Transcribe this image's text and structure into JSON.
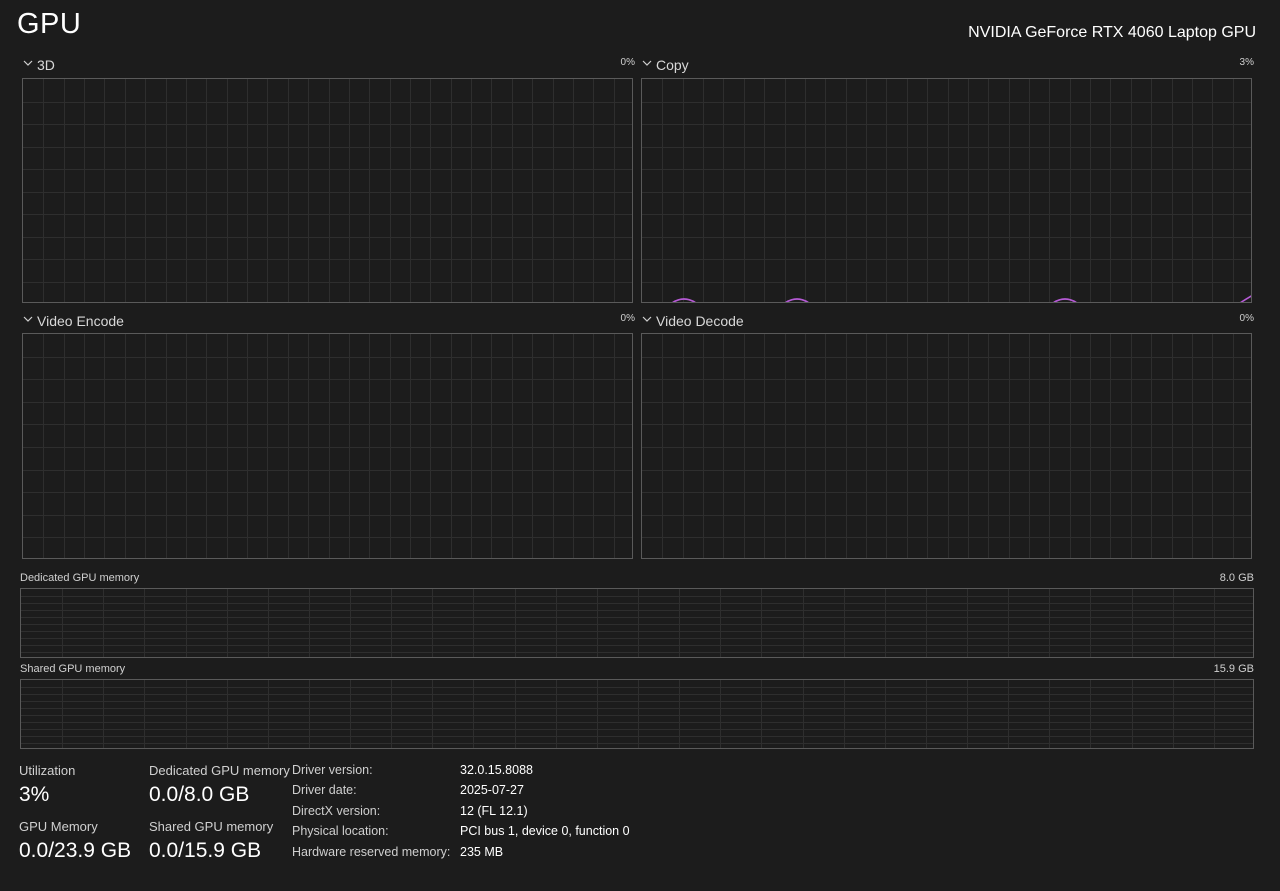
{
  "header": {
    "title": "GPU",
    "device_name": "NVIDIA GeForce RTX 4060 Laptop GPU"
  },
  "engines": [
    {
      "name": "3D",
      "percent": "0%"
    },
    {
      "name": "Copy",
      "percent": "3%"
    },
    {
      "name": "Video Encode",
      "percent": "0%"
    },
    {
      "name": "Video Decode",
      "percent": "0%"
    }
  ],
  "memory_graphs": {
    "dedicated": {
      "label": "Dedicated GPU memory",
      "max": "8.0 GB"
    },
    "shared": {
      "label": "Shared GPU memory",
      "max": "15.9 GB"
    }
  },
  "stats": {
    "utilization": {
      "label": "Utilization",
      "value": "3%"
    },
    "dedicated_memory": {
      "label": "Dedicated GPU memory",
      "value": "0.0/8.0 GB"
    },
    "gpu_memory": {
      "label": "GPU Memory",
      "value": "0.0/23.9 GB"
    },
    "shared_memory": {
      "label": "Shared GPU memory",
      "value": "0.0/15.9 GB"
    }
  },
  "details": [
    {
      "key": "Driver version:",
      "value": "32.0.15.8088"
    },
    {
      "key": "Driver date:",
      "value": "2025-07-27"
    },
    {
      "key": "DirectX version:",
      "value": "12 (FL 12.1)"
    },
    {
      "key": "Physical location:",
      "value": "PCI bus 1, device 0, function 0"
    },
    {
      "key": "Hardware reserved memory:",
      "value": "235 MB"
    }
  ],
  "colors": {
    "background": "#1c1c1c",
    "grid": "#2e2e2e",
    "border": "#5a5a5a",
    "engine_line": "#b65ad6"
  },
  "icons": {
    "collapse": "chevron-down-icon"
  }
}
